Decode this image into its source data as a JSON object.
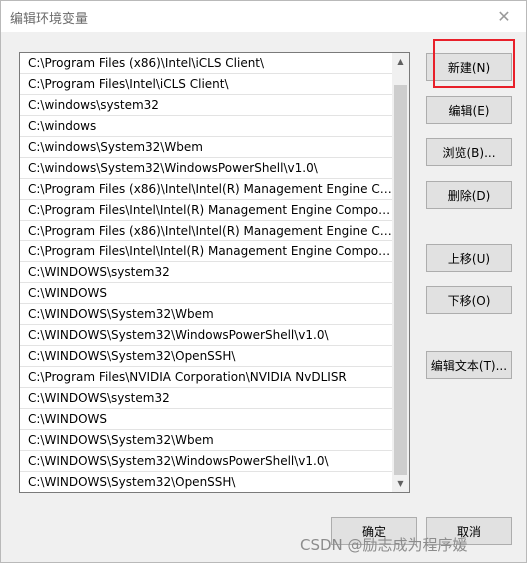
{
  "window": {
    "title": "编辑环境变量",
    "close_glyph": "✕"
  },
  "path_list": {
    "items": [
      "C:\\Program Files (x86)\\Intel\\iCLS Client\\",
      "C:\\Program Files\\Intel\\iCLS Client\\",
      "C:\\windows\\system32",
      "C:\\windows",
      "C:\\windows\\System32\\Wbem",
      "C:\\windows\\System32\\WindowsPowerShell\\v1.0\\",
      "C:\\Program Files (x86)\\Intel\\Intel(R) Management Engine Co...",
      "C:\\Program Files\\Intel\\Intel(R) Management Engine Compon...",
      "C:\\Program Files (x86)\\Intel\\Intel(R) Management Engine Co...",
      "C:\\Program Files\\Intel\\Intel(R) Management Engine Compon...",
      "C:\\WINDOWS\\system32",
      "C:\\WINDOWS",
      "C:\\WINDOWS\\System32\\Wbem",
      "C:\\WINDOWS\\System32\\WindowsPowerShell\\v1.0\\",
      "C:\\WINDOWS\\System32\\OpenSSH\\",
      "C:\\Program Files\\NVIDIA Corporation\\NVIDIA NvDLISR",
      "C:\\WINDOWS\\system32",
      "C:\\WINDOWS",
      "C:\\WINDOWS\\System32\\Wbem",
      "C:\\WINDOWS\\System32\\WindowsPowerShell\\v1.0\\",
      "C:\\WINDOWS\\System32\\OpenSSH\\"
    ],
    "scroll_up_glyph": "▲",
    "scroll_down_glyph": "▼"
  },
  "buttons": {
    "new": "新建(N)",
    "edit": "编辑(E)",
    "browse": "浏览(B)...",
    "delete": "删除(D)",
    "move_up": "上移(U)",
    "move_down": "下移(O)",
    "edit_text": "编辑文本(T)...",
    "ok": "确定",
    "cancel": "取消"
  },
  "watermark": "CSDN @励志成为程序媛",
  "colors": {
    "highlight": "#e8202a"
  }
}
